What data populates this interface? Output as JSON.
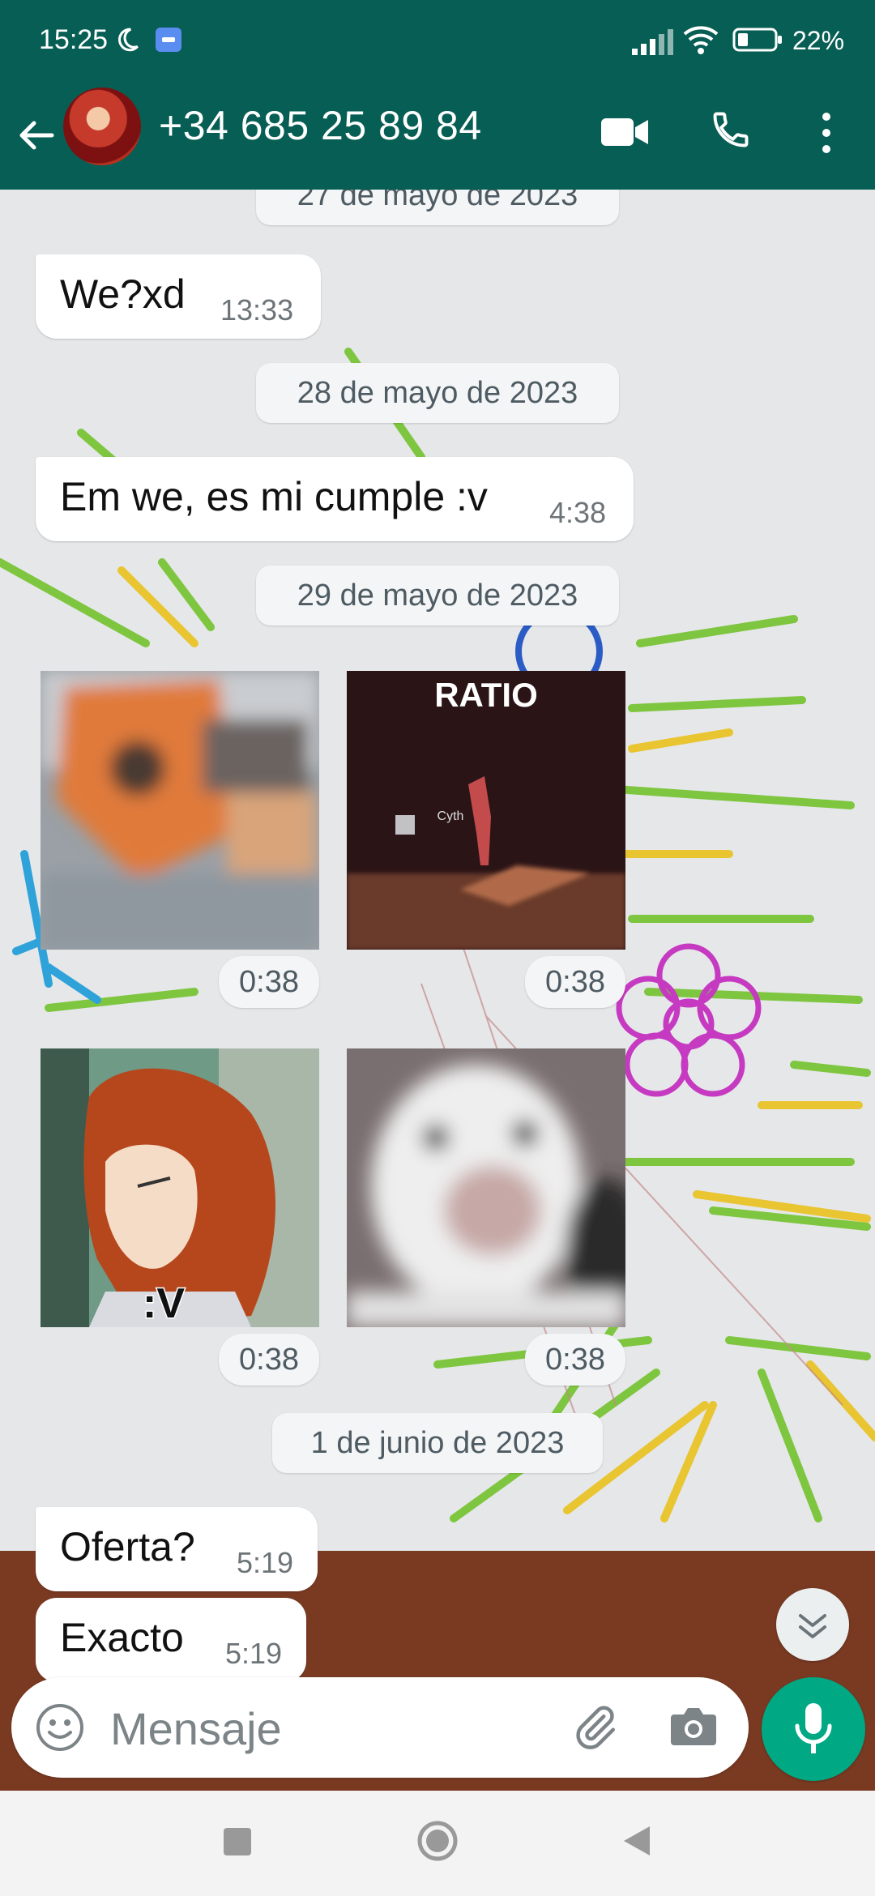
{
  "status_bar": {
    "time": "15:25",
    "battery": "22%"
  },
  "header": {
    "contact_name": "+34 685 25 89 84"
  },
  "messages": [
    {
      "type": "date",
      "label": "27 de mayo de 2023"
    },
    {
      "type": "text",
      "text": "We?xd",
      "time": "13:33"
    },
    {
      "type": "date",
      "label": "28 de mayo de 2023"
    },
    {
      "type": "text",
      "text": "Em we, es mi cumple :v",
      "time": "4:38"
    },
    {
      "type": "date",
      "label": "29 de mayo de 2023"
    },
    {
      "type": "sticker",
      "time": "0:38"
    },
    {
      "type": "sticker",
      "caption": "RATIO",
      "subcaption": "Cyth",
      "time": "0:38"
    },
    {
      "type": "sticker",
      "caption": ":V",
      "time": "0:38"
    },
    {
      "type": "sticker",
      "time": "0:38"
    },
    {
      "type": "date",
      "label": "1 de junio de 2023"
    },
    {
      "type": "text",
      "text": "Oferta?",
      "time": "5:19"
    },
    {
      "type": "text",
      "text": "Exacto",
      "time": "5:19"
    }
  ],
  "composer": {
    "placeholder": "Mensaje"
  },
  "icons": {
    "back": "arrow-left-icon",
    "video": "video-camera-icon",
    "call": "phone-icon",
    "more": "more-vert-icon",
    "emoji": "emoji-icon",
    "attach": "paperclip-icon",
    "camera": "camera-icon",
    "mic": "microphone-icon",
    "scroll": "double-chevron-down-icon"
  },
  "colors": {
    "header": "#075e54",
    "accent": "#00a884",
    "bubble": "#ffffff"
  }
}
